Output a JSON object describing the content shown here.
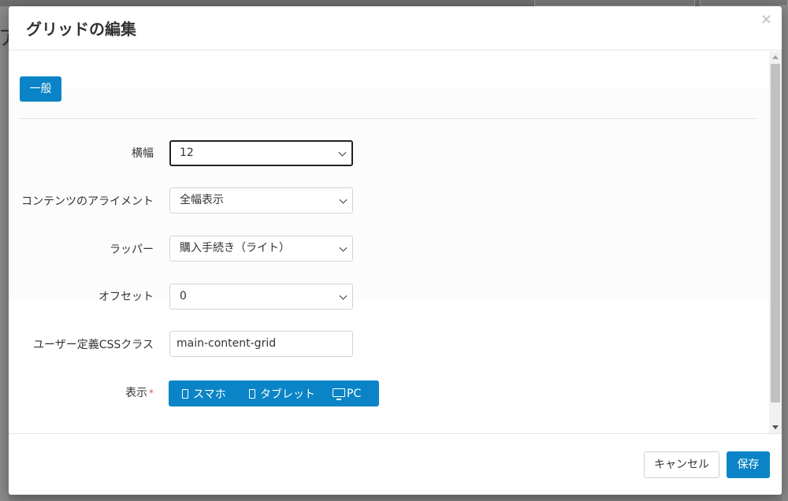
{
  "backdrop": {
    "left_glyph": "ア"
  },
  "modal": {
    "title": "グリッドの編集",
    "close_glyph": "×"
  },
  "tabs": [
    {
      "label": "一般",
      "active": true
    }
  ],
  "form": {
    "width": {
      "label": "横幅",
      "value": "12"
    },
    "alignment": {
      "label": "コンテンツのアライメント",
      "value": "全幅表示"
    },
    "wrapper": {
      "label": "ラッパー",
      "value": "購入手続き（ライト）"
    },
    "offset": {
      "label": "オフセット",
      "value": "0"
    },
    "css_class": {
      "label": "ユーザー定義CSSクラス",
      "value": "main-content-grid"
    },
    "display": {
      "label": "表示",
      "required_mark": "*",
      "options": [
        {
          "label": "スマホ",
          "icon": "smartphone-icon"
        },
        {
          "label": "タブレット",
          "icon": "tablet-icon"
        },
        {
          "label": "PC",
          "icon": "monitor-icon"
        }
      ]
    }
  },
  "footer": {
    "cancel_label": "キャンセル",
    "save_label": "保存"
  },
  "colors": {
    "primary": "#0a84c6",
    "required": "#d9534f",
    "overlay": "#7f7f7f"
  }
}
